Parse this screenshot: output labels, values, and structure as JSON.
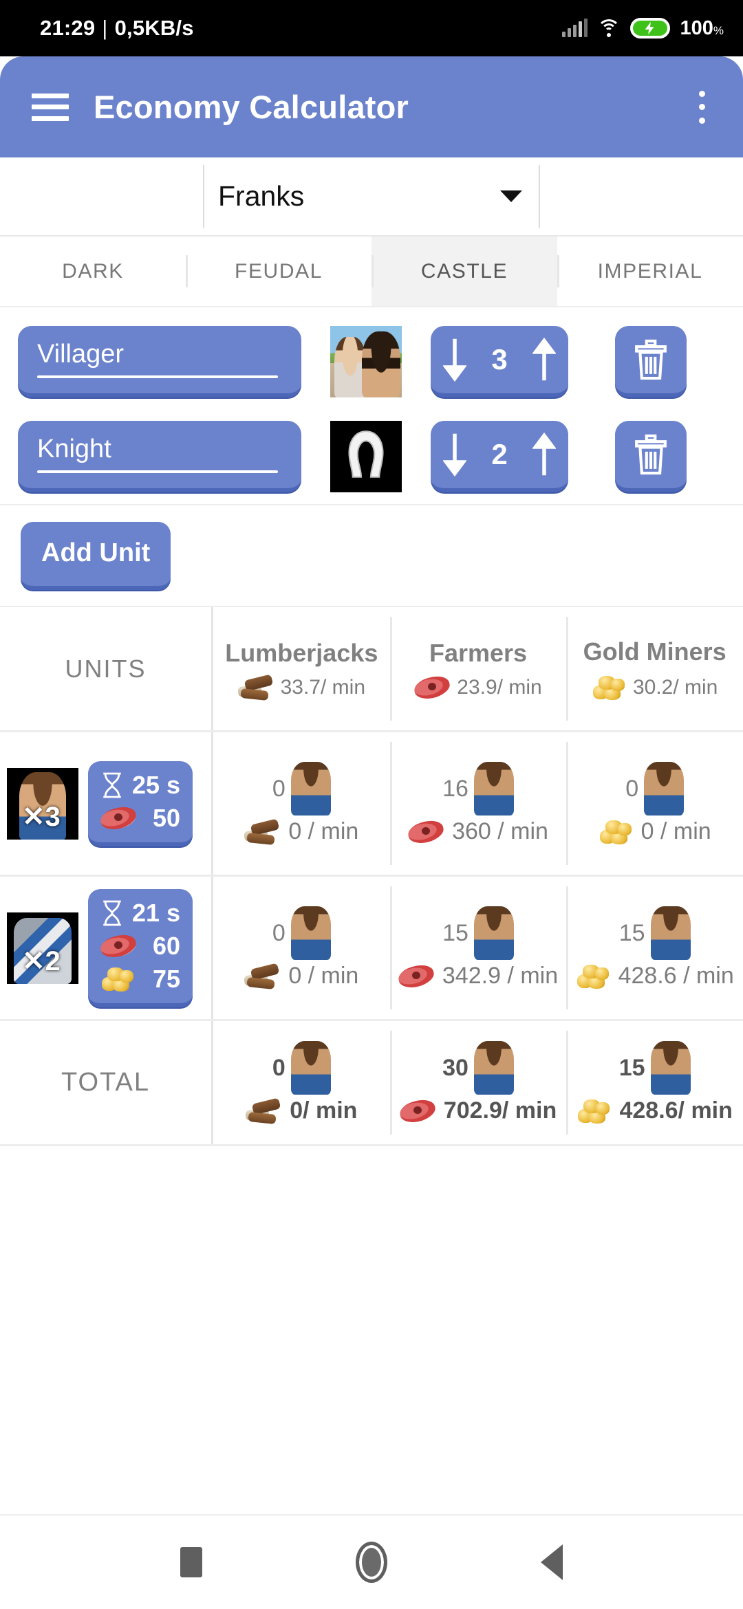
{
  "status_bar": {
    "time": "21:29",
    "separator": "|",
    "net_speed": "0,5KB/s",
    "battery_pct": "100",
    "battery_unit": "%",
    "icons": [
      "signal-icon",
      "wifi-icon",
      "battery-charging-icon"
    ]
  },
  "app_bar": {
    "menu_icon": "hamburger-menu-icon",
    "title": "Economy Calculator",
    "overflow_icon": "more-vertical-icon",
    "color": "#6b82cc"
  },
  "civ_select": {
    "value": "Franks",
    "caret_icon": "chevron-down-icon"
  },
  "age_tabs": {
    "items": [
      {
        "label": "DARK",
        "active": false
      },
      {
        "label": "FEUDAL",
        "active": false
      },
      {
        "label": "CASTLE",
        "active": true
      },
      {
        "label": "IMPERIAL",
        "active": false
      }
    ]
  },
  "unit_editor": {
    "rows": [
      {
        "name": "Villager",
        "thumb": "villager-portrait",
        "count": "3",
        "down_icon": "arrow-down-icon",
        "up_icon": "arrow-up-icon",
        "delete_icon": "trash-icon"
      },
      {
        "name": "Knight",
        "thumb": "horseshoe-icon",
        "count": "2",
        "down_icon": "arrow-down-icon",
        "up_icon": "arrow-up-icon",
        "delete_icon": "trash-icon"
      }
    ],
    "add_label": "Add Unit"
  },
  "table": {
    "units_header": "UNITS",
    "total_label": "TOTAL",
    "columns": [
      {
        "title": "Lumberjacks",
        "icon": "wood-icon",
        "rate": "33.7/ min"
      },
      {
        "title": "Farmers",
        "icon": "meat-icon",
        "rate": "23.9/ min"
      },
      {
        "title": "Gold Miners",
        "icon": "gold-icon",
        "rate": "30.2/ min"
      }
    ],
    "rows": [
      {
        "unit_thumb": "villager-unit-icon",
        "multiplier": "✕3",
        "cost": {
          "time_icon": "hourglass-icon",
          "time": "25 s",
          "lines": [
            {
              "icon": "meat-icon",
              "value": "50"
            }
          ]
        },
        "cells": [
          {
            "villagers": "0",
            "icon": "wood-icon",
            "rate": "0 / min"
          },
          {
            "villagers": "16",
            "icon": "meat-icon",
            "rate": "360 / min"
          },
          {
            "villagers": "0",
            "icon": "gold-icon",
            "rate": "0 / min"
          }
        ]
      },
      {
        "unit_thumb": "knight-unit-icon",
        "multiplier": "✕2",
        "cost": {
          "time_icon": "hourglass-icon",
          "time": "21 s",
          "lines": [
            {
              "icon": "meat-icon",
              "value": "60"
            },
            {
              "icon": "gold-icon",
              "value": "75"
            }
          ]
        },
        "cells": [
          {
            "villagers": "0",
            "icon": "wood-icon",
            "rate": "0 / min"
          },
          {
            "villagers": "15",
            "icon": "meat-icon",
            "rate": "342.9 / min"
          },
          {
            "villagers": "15",
            "icon": "gold-icon",
            "rate": "428.6 / min"
          }
        ]
      }
    ],
    "total": [
      {
        "villagers": "0",
        "icon": "wood-icon",
        "rate": "0/ min"
      },
      {
        "villagers": "30",
        "icon": "meat-icon",
        "rate": "702.9/ min"
      },
      {
        "villagers": "15",
        "icon": "gold-icon",
        "rate": "428.6/ min"
      }
    ]
  },
  "nav_bar": {
    "recents_icon": "square-recents-icon",
    "home_icon": "circle-home-icon",
    "back_icon": "triangle-back-icon"
  }
}
